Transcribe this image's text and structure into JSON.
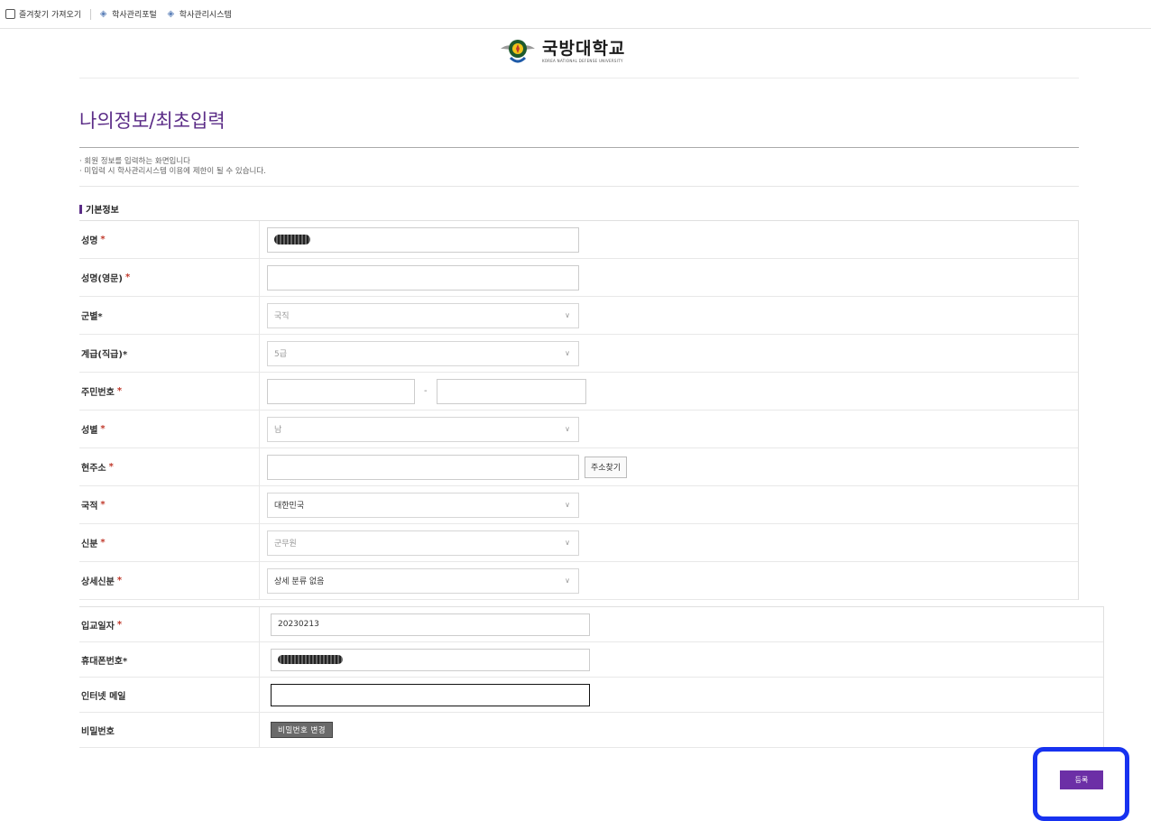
{
  "bookmarks": [
    {
      "label": "즐겨찾기 가져오기",
      "icon": "folder-icon"
    },
    {
      "label": "학사관리포털",
      "icon": "diamond-icon"
    },
    {
      "label": "학사관리시스템",
      "icon": "diamond-icon"
    }
  ],
  "logo": {
    "korean": "국방대학교",
    "english": "KOREA NATIONAL DEFENSE UNIVERSITY"
  },
  "page_title": "나의정보/최초입력",
  "notes": [
    "· 회원 정보를 입력하는 화면입니다",
    "· 미입력 시 학사관리시스템 이용에 제한이 될 수 있습니다."
  ],
  "section_title": "기본정보",
  "fields": {
    "name": {
      "label": "성명",
      "req": "*"
    },
    "name_en": {
      "label": "성명(영문)",
      "req": "*",
      "value": ""
    },
    "service": {
      "label": "군별*",
      "value": "국직"
    },
    "rank": {
      "label": "계급(직급)*",
      "value": "5급"
    },
    "rrn": {
      "label": "주민번호",
      "req": "*",
      "separator": "-"
    },
    "gender": {
      "label": "성별",
      "req": "*",
      "value": "남"
    },
    "address": {
      "label": "현주소",
      "req": "*",
      "button": "주소찾기"
    },
    "nationality": {
      "label": "국적",
      "req": "*",
      "value": "대한민국"
    },
    "status": {
      "label": "신분",
      "req": "*",
      "value": "군무원"
    },
    "status_detail": {
      "label": "상세신분",
      "req": "*",
      "value": "상세 분류 없음"
    },
    "entry_date": {
      "label": "입교일자",
      "req": "*",
      "value": "20230213"
    },
    "phone": {
      "label": "휴대폰번호*"
    },
    "email": {
      "label": "인터넷 메일",
      "value": ""
    },
    "password": {
      "label": "비밀번호",
      "button": "비밀번호 변경"
    }
  },
  "submit_label": "등록",
  "colors": {
    "accent": "#6c2fa6",
    "title": "#5b2c87",
    "highlight": "#1732f0"
  }
}
